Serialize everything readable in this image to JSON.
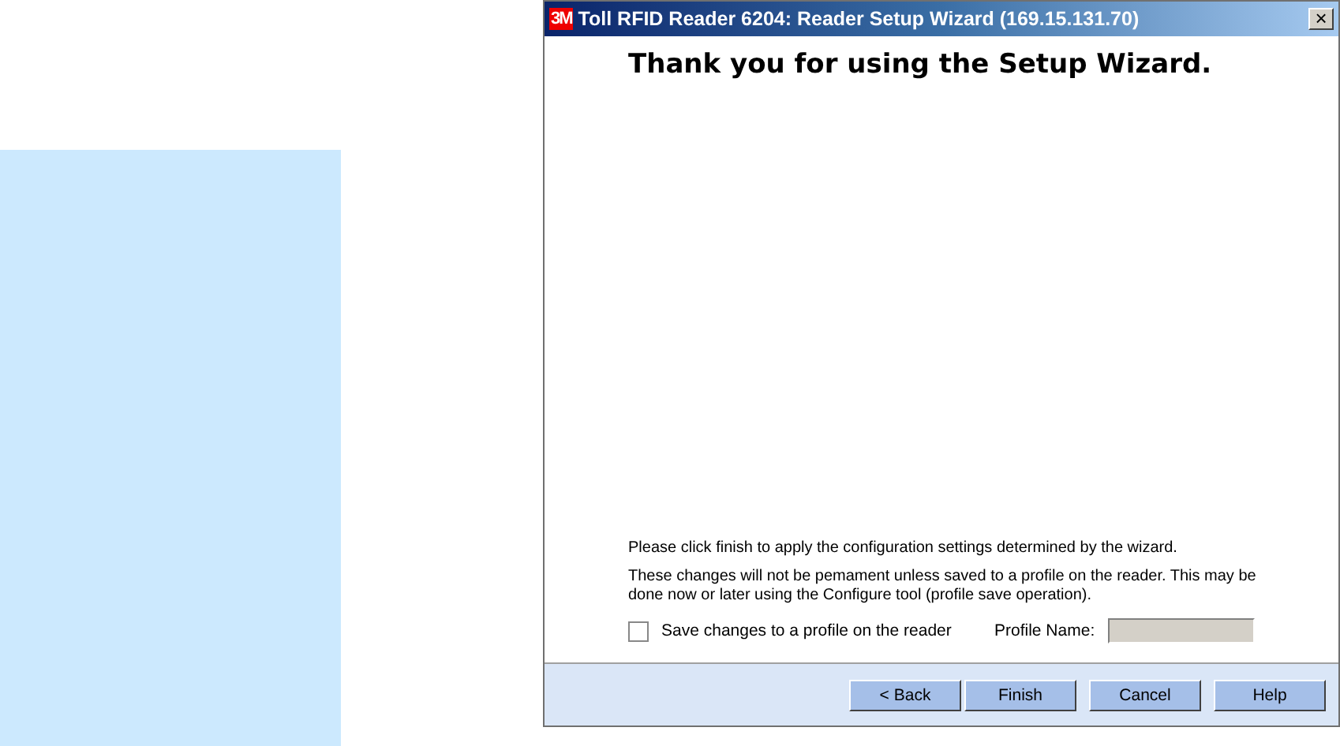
{
  "window": {
    "logo": "3M",
    "title": "Toll RFID Reader 6204: Reader Setup Wizard (169.15.131.70)",
    "close": "×"
  },
  "heading": "Thank you for using the Setup Wizard.",
  "paragraphs": [
    "Please click finish to apply the configuration settings determined by the wizard.",
    "These changes will not be pemament unless saved to a profile on the reader.  This may be done now or later using the Configure tool (profile save operation)."
  ],
  "save_checkbox": {
    "label": "Save changes to a profile on the reader",
    "checked": false
  },
  "profile_name": {
    "label": "Profile Name:",
    "disabled": true
  },
  "buttons": [
    "< Back",
    "Finish",
    "Cancel",
    "Help"
  ]
}
